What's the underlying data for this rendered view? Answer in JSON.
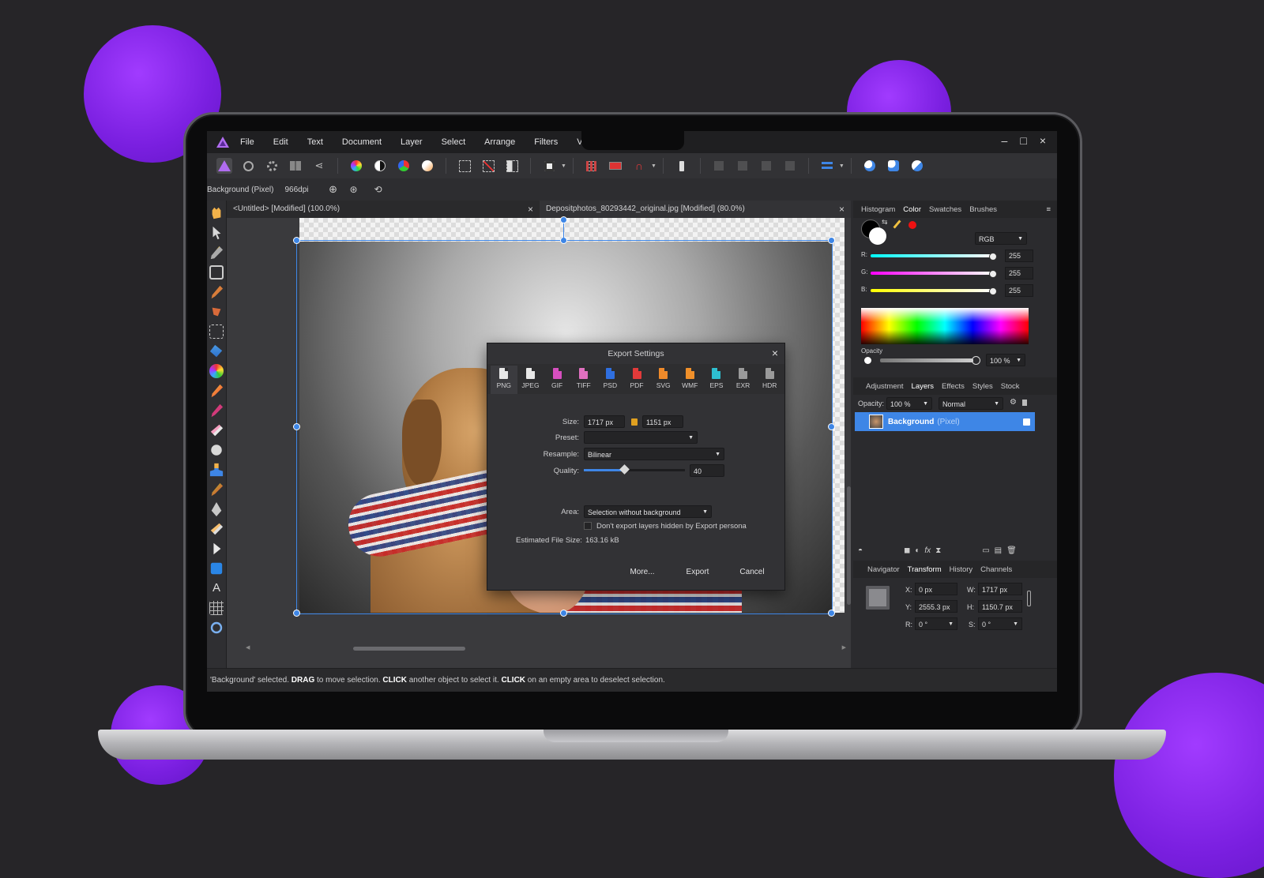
{
  "menu": [
    "File",
    "Edit",
    "Text",
    "Document",
    "Layer",
    "Select",
    "Arrange",
    "Filters",
    "View"
  ],
  "context": {
    "layer_label": "Background (Pixel)",
    "dpi": "966dpi"
  },
  "tabs": [
    {
      "title": "<Untitled> [Modified] (100.0%)",
      "close": "×"
    },
    {
      "title": "Depositphotos_80293442_original.jpg [Modified] (80.0%)",
      "close": "×"
    }
  ],
  "window_controls": {
    "min": "–",
    "max": "□",
    "close": "×"
  },
  "dialog": {
    "title": "Export Settings",
    "close": "×",
    "formats": [
      "PNG",
      "JPEG",
      "GIF",
      "TIFF",
      "PSD",
      "PDF",
      "SVG",
      "WMF",
      "EPS",
      "EXR",
      "HDR"
    ],
    "format_colors": [
      "#e8e8e8",
      "#e8e8e8",
      "#d64fbf",
      "#e070c0",
      "#2f6fe0",
      "#e23a3a",
      "#ef8a2a",
      "#f0902a",
      "#2ebfd0",
      "#9a9a9a",
      "#9a9a9a"
    ],
    "size_label": "Size:",
    "width": "1717 px",
    "height": "1151 px",
    "preset_label": "Preset:",
    "preset_value": "",
    "resample_label": "Resample:",
    "resample_value": "Bilinear",
    "quality_label": "Quality:",
    "quality_value": "40",
    "quality_fraction": 0.4,
    "area_label": "Area:",
    "area_value": "Selection without background",
    "checkbox_label": "Don't export layers hidden by Export persona",
    "estimate_label": "Estimated File Size:",
    "estimate_value": "163.16 kB",
    "more_label": "More...",
    "export_label": "Export",
    "cancel_label": "Cancel"
  },
  "color_panel": {
    "tabs": [
      "Histogram",
      "Color",
      "Swatches",
      "Brushes"
    ],
    "active_tab": "Color",
    "model": "RGB",
    "r_label": "R:",
    "g_label": "G:",
    "b_label": "B:",
    "r": "255",
    "g": "255",
    "b": "255",
    "opacity_label": "Opacity",
    "opacity": "100 %"
  },
  "layers_panel": {
    "tabs": [
      "Adjustment",
      "Layers",
      "Effects",
      "Styles",
      "Stock"
    ],
    "active_tab": "Layers",
    "opacity_label": "Opacity:",
    "opacity": "100 %",
    "blend": "Normal",
    "layer_name": "Background",
    "layer_type": "(Pixel)"
  },
  "transform_panel": {
    "tabs": [
      "Navigator",
      "Transform",
      "History",
      "Channels"
    ],
    "active_tab": "Transform",
    "x_label": "X:",
    "x": "0 px",
    "y_label": "Y:",
    "y": "2555.3 px",
    "w_label": "W:",
    "w": "1717 px",
    "h_label": "H:",
    "h": "1150.7 px",
    "r_label": "R:",
    "r": "0 °",
    "s_label": "S:",
    "s": "0 °"
  },
  "status": {
    "p1": "'Background' selected. ",
    "b1": "DRAG",
    "p2": " to move selection. ",
    "b2": "CLICK",
    "p3": " another object to select it. ",
    "b3": "CLICK",
    "p4": " on an empty area to deselect selection."
  },
  "colors": {
    "accent": "#3e86e6",
    "bg": "#262528",
    "purple": "#8a2be2"
  }
}
